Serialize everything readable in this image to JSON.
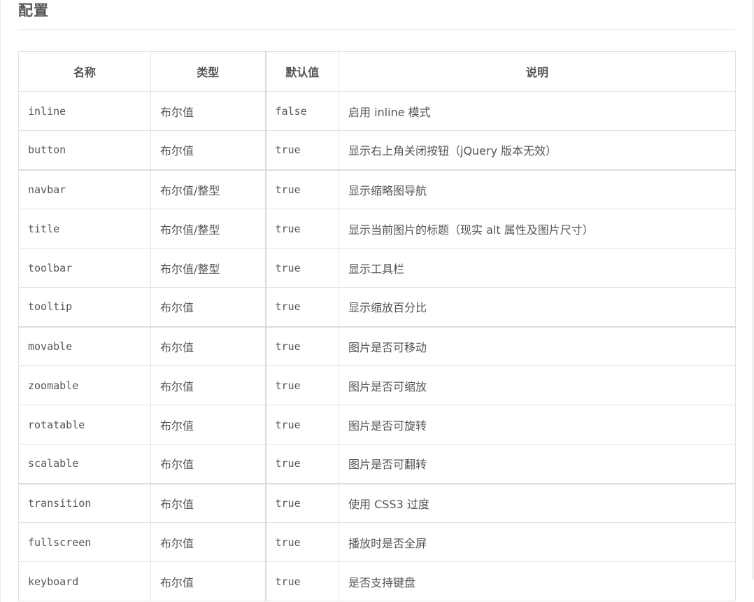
{
  "section": {
    "title": "配置"
  },
  "table": {
    "headers": [
      "名称",
      "类型",
      "默认值",
      "说明"
    ],
    "rows": [
      {
        "name": "inline",
        "type": "布尔值",
        "default": "false",
        "description": "启用 inline 模式"
      },
      {
        "name": "button",
        "type": "布尔值",
        "default": "true",
        "description": "显示右上角关闭按钮（jQuery 版本无效）"
      },
      {
        "name": "navbar",
        "type": "布尔值/整型",
        "default": "true",
        "description": "显示缩略图导航"
      },
      {
        "name": "title",
        "type": "布尔值/整型",
        "default": "true",
        "description": "显示当前图片的标题（现实 alt 属性及图片尺寸）"
      },
      {
        "name": "toolbar",
        "type": "布尔值/整型",
        "default": "true",
        "description": "显示工具栏"
      },
      {
        "name": "tooltip",
        "type": "布尔值",
        "default": "true",
        "description": "显示缩放百分比"
      },
      {
        "name": "movable",
        "type": "布尔值",
        "default": "true",
        "description": "图片是否可移动"
      },
      {
        "name": "zoomable",
        "type": "布尔值",
        "default": "true",
        "description": "图片是否可缩放"
      },
      {
        "name": "rotatable",
        "type": "布尔值",
        "default": "true",
        "description": "图片是否可旋转"
      },
      {
        "name": "scalable",
        "type": "布尔值",
        "default": "true",
        "description": "图片是否可翻转"
      },
      {
        "name": "transition",
        "type": "布尔值",
        "default": "true",
        "description": "使用 CSS3 过度"
      },
      {
        "name": "fullscreen",
        "type": "布尔值",
        "default": "true",
        "description": "播放时是否全屏"
      },
      {
        "name": "keyboard",
        "type": "布尔值",
        "default": "true",
        "description": "是否支持键盘"
      }
    ]
  },
  "colors": {
    "text": "#555555",
    "border": "#e2e2e2",
    "background": "#ffffff"
  }
}
